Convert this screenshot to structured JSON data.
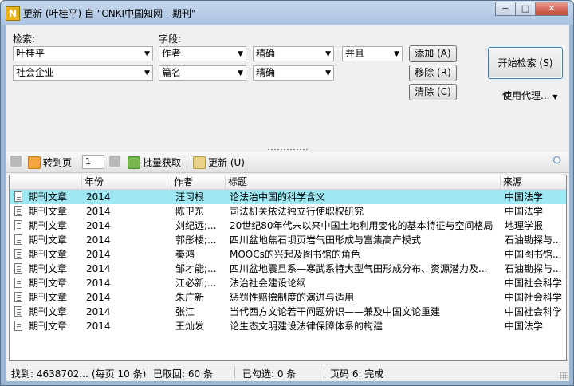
{
  "window": {
    "title": "更新 (叶桂平) 自 \"CNKI中国知网 - 期刊\"",
    "app_icon_letter": "N",
    "minimize": "−",
    "maximize": "□",
    "close": "✕"
  },
  "search": {
    "keyword_label": "检索:",
    "field_label": "字段:",
    "rows": [
      {
        "keyword": "叶桂平",
        "field": "作者",
        "match": "精确",
        "logic": "并且"
      },
      {
        "keyword": "社会企业",
        "field": "篇名",
        "match": "精确"
      }
    ],
    "add_button": "添加 (A)",
    "remove_button": "移除 (R)",
    "clear_button": "清除 (C)",
    "start_button": "开始检索 (S)",
    "proxy_label": "使用代理..."
  },
  "toolbar": {
    "goto_label": "转到页",
    "page_value": "1",
    "batch_label": "批量获取",
    "update_label": "更新 (U)"
  },
  "table": {
    "headers": [
      "年份",
      "作者",
      "标题",
      "来源"
    ],
    "rows": [
      {
        "type": "期刊文章",
        "year": "2014",
        "author": "汪习根",
        "title": "论法治中国的科学含义",
        "source": "中国法学"
      },
      {
        "type": "期刊文章",
        "year": "2014",
        "author": "陈卫东",
        "title": "司法机关依法独立行使职权研究",
        "source": "中国法学"
      },
      {
        "type": "期刊文章",
        "year": "2014",
        "author": "刘纪远;...",
        "title": "20世纪80年代末以来中国土地利用变化的基本特征与空间格局",
        "source": "地理学报"
      },
      {
        "type": "期刊文章",
        "year": "2014",
        "author": "郭彤楼;...",
        "title": "四川盆地焦石坝页岩气田形成与富集高产模式",
        "source": "石油勘探与..."
      },
      {
        "type": "期刊文章",
        "year": "2014",
        "author": "秦鸿",
        "title": "MOOCs的兴起及图书馆的角色",
        "source": "中国图书馆..."
      },
      {
        "type": "期刊文章",
        "year": "2014",
        "author": "邹才能;...",
        "title": "四川盆地震旦系—寒武系特大型气田形成分布、资源潜力及...",
        "source": "石油勘探与..."
      },
      {
        "type": "期刊文章",
        "year": "2014",
        "author": "江必新;...",
        "title": "法治社会建设论纲",
        "source": "中国社会科学"
      },
      {
        "type": "期刊文章",
        "year": "2014",
        "author": "朱广新",
        "title": "惩罚性赔偿制度的演进与适用",
        "source": "中国社会科学"
      },
      {
        "type": "期刊文章",
        "year": "2014",
        "author": "张江",
        "title": "当代西方文论若干问题辨识——兼及中国文论重建",
        "source": "中国社会科学"
      },
      {
        "type": "期刊文章",
        "year": "2014",
        "author": "王灿发",
        "title": "论生态文明建设法律保障体系的构建",
        "source": "中国法学"
      }
    ]
  },
  "status": {
    "found": "找到: 4638702...",
    "per_page": "(每页 10 条)",
    "retrieved": "已取回: 60 条",
    "checked": "已勾选: 0 条",
    "page_status": "页码 6: 完成"
  },
  "colors": {
    "selected_row": "#9ee8f4",
    "accent": "#3c7fb1"
  }
}
